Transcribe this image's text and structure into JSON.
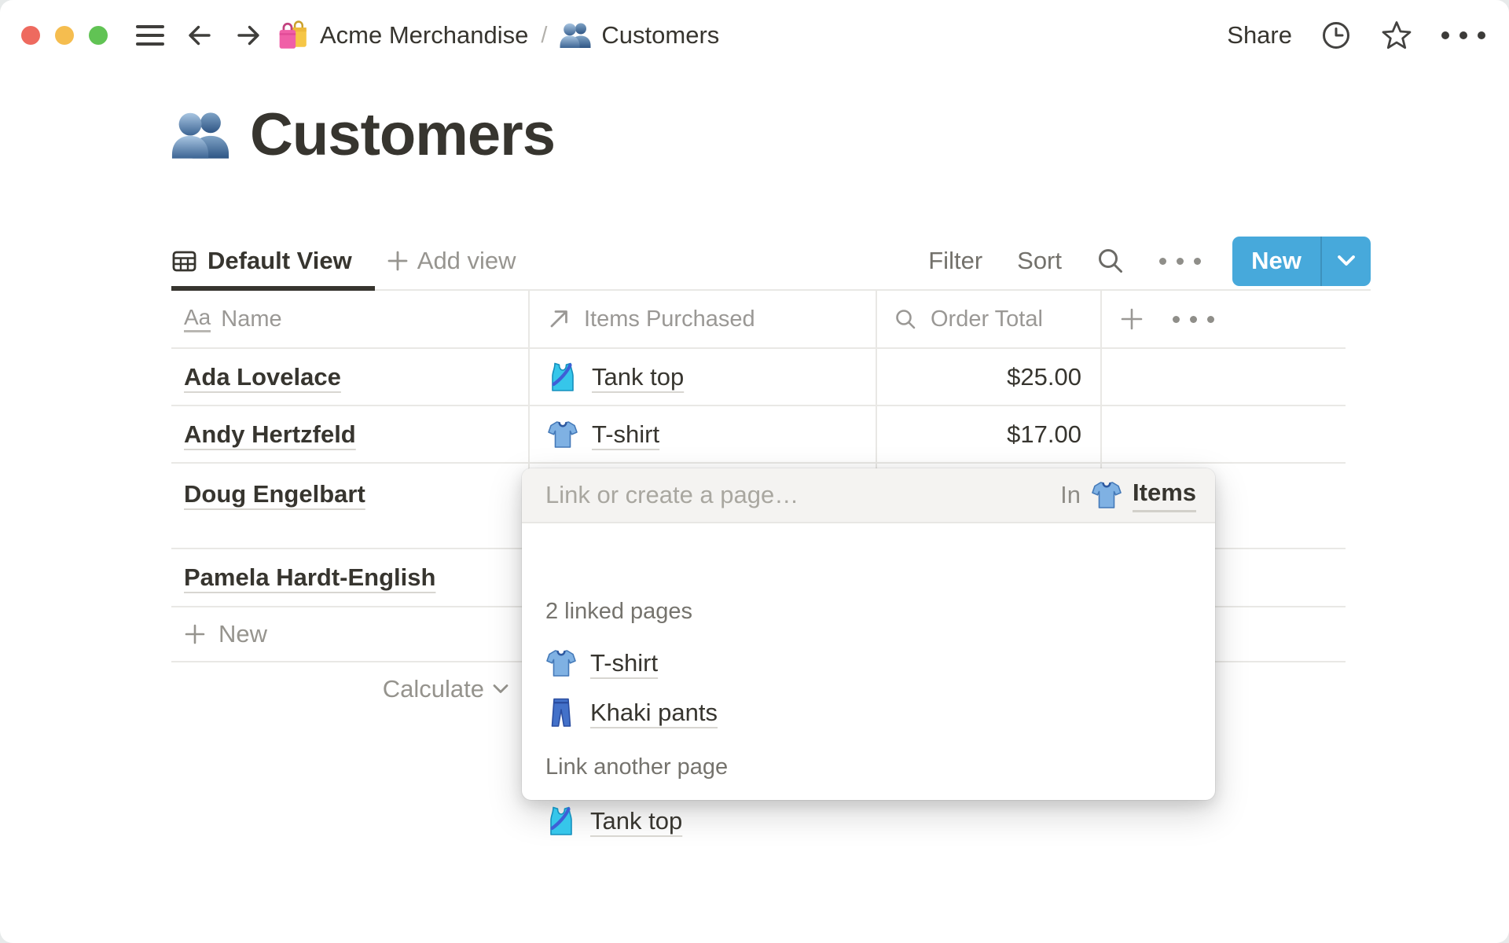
{
  "topbar": {
    "breadcrumb": {
      "workspace": "Acme Merchandise",
      "separator": "/",
      "page": "Customers"
    },
    "share_label": "Share"
  },
  "page": {
    "title": "Customers"
  },
  "view_bar": {
    "active_view": "Default View",
    "add_view_label": "Add view",
    "filter_label": "Filter",
    "sort_label": "Sort",
    "new_button_label": "New"
  },
  "table": {
    "columns": [
      {
        "label": "Name",
        "type": "title"
      },
      {
        "label": "Items Purchased",
        "type": "relation"
      },
      {
        "label": "Order Total",
        "type": "rollup"
      }
    ],
    "rows": [
      {
        "name": "Ada Lovelace",
        "item": "Tank top",
        "item_icon": "tank-top-icon",
        "total": "$25.00"
      },
      {
        "name": "Andy Hertzfeld",
        "item": "T-shirt",
        "item_icon": "t-shirt-icon",
        "total": "$17.00"
      },
      {
        "name": "Doug Engelbart",
        "item": "",
        "total": ""
      },
      {
        "name": "Pamela Hardt-English",
        "item": "",
        "total": ""
      }
    ],
    "new_row_label": "New",
    "calculate_label": "Calculate"
  },
  "popup": {
    "placeholder": "Link or create a page…",
    "scope_prefix": "In",
    "scope_name": "Items",
    "scope_icon": "t-shirt-icon",
    "linked_count_label": "2 linked pages",
    "linked_pages": [
      {
        "label": "T-shirt",
        "icon": "t-shirt-icon"
      },
      {
        "label": "Khaki pants",
        "icon": "jeans-icon"
      }
    ],
    "link_another_label": "Link another page",
    "suggested_pages": [
      {
        "label": "Tank top",
        "icon": "tank-top-icon"
      }
    ]
  },
  "icons": {
    "shopping-bags-icon": "🛍️",
    "people-icon": "👥",
    "t-shirt-icon": "👕",
    "tank-top-icon": "🎽",
    "jeans-icon": "👖",
    "hamburger-icon": "three-lines",
    "back-icon": "arrow-left",
    "forward-icon": "arrow-right",
    "history-icon": "clock",
    "favorite-icon": "star-outline",
    "more-icon": "ellipsis",
    "table-view-icon": "grid",
    "plus-icon": "plus",
    "search-icon": "magnifier",
    "title-property-icon": "Aa",
    "relation-property-icon": "arrow-up-right",
    "rollup-property-icon": "magnifier",
    "chevron-down-icon": "chevron-down"
  },
  "colors": {
    "accent_blue": "#47a9db",
    "ink": "#37352f",
    "muted_gray": "#96948e",
    "border_gray": "#e9e8e5",
    "traffic_red": "#ee6a5f",
    "traffic_yellow": "#f5bd4f",
    "traffic_green": "#61c354"
  }
}
